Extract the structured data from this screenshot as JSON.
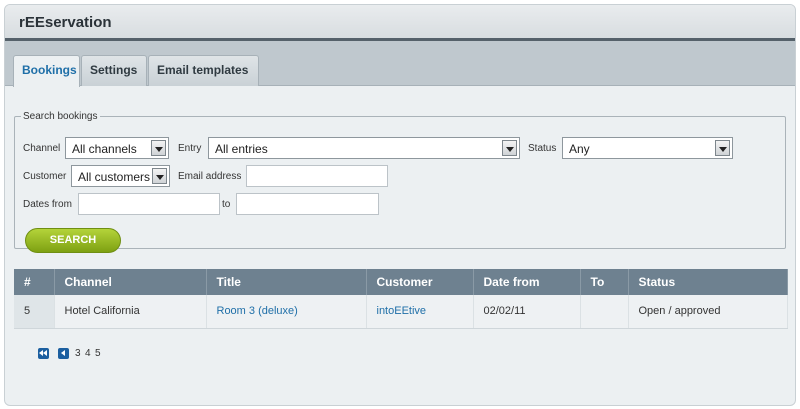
{
  "app": {
    "title": "rEEservation"
  },
  "tabs": [
    {
      "label": "Bookings",
      "active": true
    },
    {
      "label": "Settings",
      "active": false
    },
    {
      "label": "Email templates",
      "active": false
    }
  ],
  "search": {
    "legend": "Search bookings",
    "channel_label": "Channel",
    "channel_value": "All channels",
    "entry_label": "Entry",
    "entry_value": "All entries",
    "status_label": "Status",
    "status_value": "Any",
    "customer_label": "Customer",
    "customer_value": "All customers",
    "email_label": "Email address",
    "email_value": "",
    "dates_from_label": "Dates from",
    "dates_from_value": "",
    "to_label": "to",
    "to_value": "",
    "button_label": "SEARCH"
  },
  "table": {
    "columns": [
      "#",
      "Channel",
      "Title",
      "Customer",
      "Date from",
      "To",
      "Status"
    ],
    "rows": [
      {
        "id": "5",
        "channel": "Hotel California",
        "title": "Room 3 (deluxe)",
        "customer": "intoEEtive",
        "date_from": "02/02/11",
        "to": "",
        "status": "Open / approved"
      }
    ]
  },
  "pagination": {
    "icons": [
      "first-page-icon",
      "previous-page-icon"
    ],
    "pages": [
      "3",
      "4",
      "5"
    ]
  },
  "colors": {
    "accent": "#1f6fa8",
    "header_dark": "#55616a",
    "table_header": "#6e8190",
    "search_button": "#8fb01c"
  }
}
